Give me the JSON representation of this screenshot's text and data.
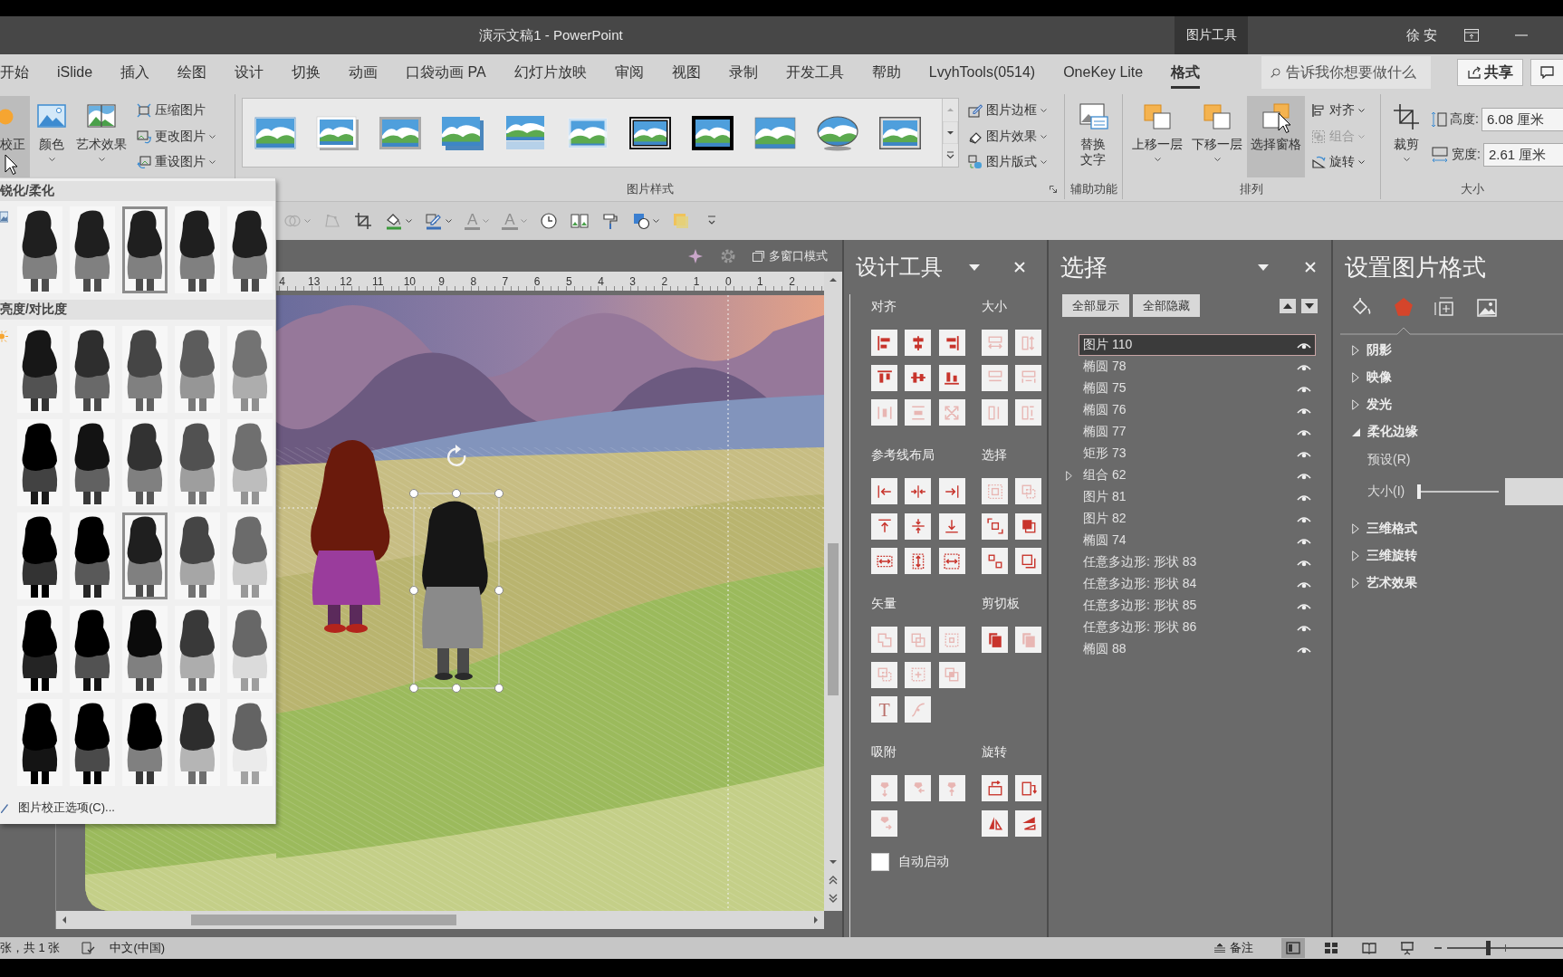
{
  "window": {
    "title": "演示文稿1 - PowerPoint",
    "context_tab": "图片工具",
    "user": "徐 安"
  },
  "ribbon_tabs": [
    {
      "label": "开始",
      "selected": false
    },
    {
      "label": "iSlide",
      "selected": false
    },
    {
      "label": "插入",
      "selected": false
    },
    {
      "label": "绘图",
      "selected": false
    },
    {
      "label": "设计",
      "selected": false
    },
    {
      "label": "切换",
      "selected": false
    },
    {
      "label": "动画",
      "selected": false
    },
    {
      "label": "口袋动画 PA",
      "selected": false
    },
    {
      "label": "幻灯片放映",
      "selected": false
    },
    {
      "label": "审阅",
      "selected": false
    },
    {
      "label": "视图",
      "selected": false
    },
    {
      "label": "录制",
      "selected": false
    },
    {
      "label": "开发工具",
      "selected": false
    },
    {
      "label": "帮助",
      "selected": false
    },
    {
      "label": "LvyhTools(0514)",
      "selected": false
    },
    {
      "label": "OneKey Lite",
      "selected": false
    },
    {
      "label": "格式",
      "selected": true
    }
  ],
  "search": {
    "placeholder": "告诉我你想要做什么"
  },
  "share_button": "共享",
  "ribbon": {
    "adjust": {
      "large_buttons": [
        {
          "label": "校正",
          "highlighted": true,
          "menu": false
        },
        {
          "label": "颜色",
          "highlighted": false,
          "menu": true
        },
        {
          "label": "艺术效果",
          "highlighted": false,
          "menu": true
        }
      ],
      "small_buttons": [
        {
          "label": "压缩图片",
          "menu": false
        },
        {
          "label": "更改图片",
          "menu": true
        },
        {
          "label": "重设图片",
          "menu": true
        }
      ]
    },
    "picture_styles": {
      "label": "图片样式",
      "gallery": [
        {
          "kind": "thin"
        },
        {
          "kind": "white-frame"
        },
        {
          "kind": "gray-frame"
        },
        {
          "kind": "drop-shadow"
        },
        {
          "kind": "reflected"
        },
        {
          "kind": "soft"
        },
        {
          "kind": "double-frame"
        },
        {
          "kind": "thick-frame"
        },
        {
          "kind": "plain"
        },
        {
          "kind": "oval"
        },
        {
          "kind": "beveled"
        }
      ],
      "small_buttons": [
        {
          "label": "图片边框",
          "menu": true
        },
        {
          "label": "图片效果",
          "menu": true
        },
        {
          "label": "图片版式",
          "menu": true
        }
      ]
    },
    "accessibility": {
      "label": "辅助功能",
      "button": "替换文字"
    },
    "arrange": {
      "label": "排列",
      "large_buttons": [
        {
          "label": "上移一层",
          "highlighted": false,
          "menu": true
        },
        {
          "label": "下移一层",
          "highlighted": false,
          "menu": true
        },
        {
          "label": "选择窗格",
          "highlighted": true,
          "menu": false
        }
      ],
      "small_buttons": [
        {
          "label": "对齐",
          "disabled": false
        },
        {
          "label": "组合",
          "disabled": true
        },
        {
          "label": "旋转",
          "disabled": false
        }
      ]
    },
    "size": {
      "label": "大小",
      "crop_button": "裁剪",
      "fields": [
        {
          "label": "高度:",
          "value": "6.08 厘米"
        },
        {
          "label": "宽度:",
          "value": "2.61 厘米"
        }
      ]
    }
  },
  "quick_access": [
    {
      "disabled": true,
      "menu": true
    },
    {
      "disabled": true,
      "menu": false
    },
    {
      "disabled": false,
      "menu": false
    },
    {
      "disabled": false,
      "menu": true
    },
    {
      "disabled": false,
      "menu": true
    },
    {
      "glyph": "A",
      "disabled": true,
      "menu": true
    },
    {
      "glyph": "A",
      "disabled": true,
      "menu": true
    },
    {
      "disabled": false,
      "menu": false
    },
    {
      "disabled": false,
      "menu": false
    },
    {
      "disabled": false,
      "menu": false
    },
    {
      "disabled": false,
      "menu": true
    },
    {
      "disabled": false,
      "menu": false
    },
    {
      "disabled": false,
      "menu": false
    }
  ],
  "corrections_menu": {
    "sections": [
      {
        "title": "锐化/柔化",
        "items": [
          {
            "selected": false
          },
          {
            "selected": false
          },
          {
            "selected": true
          },
          {
            "selected": false
          },
          {
            "selected": false
          }
        ]
      },
      {
        "title": "亮度/对比度",
        "items": [
          {
            "selected": false
          },
          {
            "selected": false
          },
          {
            "selected": false
          },
          {
            "selected": false
          },
          {
            "selected": false
          },
          {
            "selected": false
          },
          {
            "selected": false
          },
          {
            "selected": false
          },
          {
            "selected": false
          },
          {
            "selected": false
          },
          {
            "selected": false
          },
          {
            "selected": false
          },
          {
            "selected": true
          },
          {
            "selected": false
          },
          {
            "selected": false
          },
          {
            "selected": false
          },
          {
            "selected": false
          },
          {
            "selected": false
          },
          {
            "selected": false
          },
          {
            "selected": false
          },
          {
            "selected": false
          },
          {
            "selected": false
          },
          {
            "selected": false
          },
          {
            "selected": false
          },
          {
            "selected": false
          }
        ]
      }
    ],
    "footer": "图片校正选项(C)..."
  },
  "canvas": {
    "window_mode_button": "多窗口模式",
    "ruler": [
      "4",
      "13",
      "12",
      "11",
      "10",
      "9",
      "8",
      "7",
      "6",
      "5",
      "4",
      "3",
      "2",
      "1",
      "0",
      "1",
      "2"
    ]
  },
  "design_tools": {
    "title": "设计工具",
    "sections": [
      {
        "title": "对齐",
        "buttons": [
          {
            "disabled": false
          },
          {
            "disabled": false
          },
          {
            "disabled": false
          },
          {
            "disabled": false
          },
          {
            "disabled": false
          },
          {
            "disabled": false
          },
          {
            "disabled": true
          },
          {
            "disabled": true
          },
          {
            "disabled": true
          }
        ]
      },
      {
        "title": "大小",
        "buttons": [
          {
            "disabled": true
          },
          {
            "disabled": true
          },
          {
            "disabled": true
          },
          {
            "disabled": true
          },
          {
            "disabled": true
          },
          {
            "disabled": true
          }
        ]
      },
      {
        "title": "参考线布局",
        "buttons": [
          {
            "disabled": false
          },
          {
            "disabled": false
          },
          {
            "disabled": false
          },
          {
            "disabled": false
          },
          {
            "disabled": false
          },
          {
            "disabled": false
          },
          {
            "disabled": false
          },
          {
            "disabled": false
          },
          {
            "disabled": false
          }
        ]
      },
      {
        "title": "选择",
        "buttons": [
          {
            "disabled": true
          },
          {
            "disabled": true
          },
          {
            "disabled": false
          },
          {
            "disabled": false
          },
          {
            "disabled": false
          },
          {
            "disabled": false
          }
        ]
      },
      {
        "title": "矢量",
        "buttons": [
          {
            "disabled": true
          },
          {
            "disabled": true
          },
          {
            "disabled": true
          },
          {
            "disabled": true
          },
          {
            "disabled": true
          },
          {
            "disabled": true
          },
          {
            "glyph": "T",
            "disabled": true
          },
          {
            "disabled": true
          }
        ]
      },
      {
        "title": "剪切板",
        "buttons": [
          {
            "disabled": false
          },
          {
            "disabled": true
          }
        ]
      },
      {
        "title": "吸附",
        "buttons": [
          {
            "disabled": true
          },
          {
            "disabled": true
          },
          {
            "disabled": true
          },
          {
            "disabled": true
          }
        ]
      },
      {
        "title": "旋转",
        "buttons": [
          {
            "disabled": false
          },
          {
            "disabled": false
          },
          {
            "disabled": false
          },
          {
            "disabled": false
          }
        ]
      }
    ],
    "auto_start": {
      "label": "自动启动",
      "checked": false
    }
  },
  "selection_pane": {
    "title": "选择",
    "buttons": [
      "全部显示",
      "全部隐藏"
    ],
    "items": [
      {
        "name": "图片 110",
        "selected": true,
        "visible": true,
        "expandable": false
      },
      {
        "name": "椭圆 78",
        "selected": false,
        "visible": true,
        "expandable": false
      },
      {
        "name": "椭圆 75",
        "selected": false,
        "visible": true,
        "expandable": false
      },
      {
        "name": "椭圆 76",
        "selected": false,
        "visible": true,
        "expandable": false
      },
      {
        "name": "椭圆 77",
        "selected": false,
        "visible": true,
        "expandable": false
      },
      {
        "name": "矩形 73",
        "selected": false,
        "visible": true,
        "expandable": false
      },
      {
        "name": "组合 62",
        "selected": false,
        "visible": true,
        "expandable": true
      },
      {
        "name": "图片 81",
        "selected": false,
        "visible": true,
        "expandable": false
      },
      {
        "name": "图片 82",
        "selected": false,
        "visible": true,
        "expandable": false
      },
      {
        "name": "椭圆 74",
        "selected": false,
        "visible": true,
        "expandable": false
      },
      {
        "name": "任意多边形: 形状 83",
        "selected": false,
        "visible": true,
        "expandable": false
      },
      {
        "name": "任意多边形: 形状 84",
        "selected": false,
        "visible": true,
        "expandable": false
      },
      {
        "name": "任意多边形: 形状 85",
        "selected": false,
        "visible": true,
        "expandable": false
      },
      {
        "name": "任意多边形: 形状 86",
        "selected": false,
        "visible": true,
        "expandable": false
      },
      {
        "name": "椭圆 88",
        "selected": false,
        "visible": true,
        "expandable": false
      }
    ]
  },
  "format_pane": {
    "title": "设置图片格式",
    "tabs": [
      {
        "selected": false
      },
      {
        "selected": true
      },
      {
        "selected": false
      },
      {
        "selected": false
      }
    ],
    "sections": [
      {
        "label": "阴影",
        "expanded": false
      },
      {
        "label": "映像",
        "expanded": false
      },
      {
        "label": "发光",
        "expanded": false
      },
      {
        "label": "柔化边缘",
        "expanded": true,
        "options": [
          {
            "kind": "preset",
            "label": "预设(R)"
          },
          {
            "kind": "slider",
            "label": "大小(I)",
            "level": 0
          }
        ]
      },
      {
        "label": "三维格式",
        "expanded": false
      },
      {
        "label": "三维旋转",
        "expanded": false
      },
      {
        "label": "艺术效果",
        "expanded": false
      }
    ]
  },
  "status_bar": {
    "slide_info": "张，共 1 张",
    "language": "中文(中国)",
    "notes_button": "备注",
    "views": [
      {
        "selected": true
      },
      {
        "selected": false
      },
      {
        "selected": false
      },
      {
        "selected": false
      }
    ],
    "zoom": {
      "level": 0.35
    }
  }
}
